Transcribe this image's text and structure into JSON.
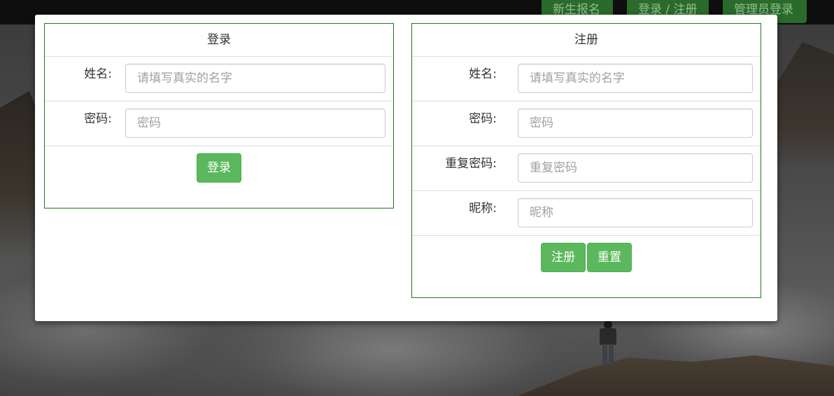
{
  "navbar": {
    "items": [
      "新生报名",
      "登录 / 注册",
      "管理员登录"
    ]
  },
  "login": {
    "title": "登录",
    "fields": [
      {
        "label": "姓名:",
        "placeholder": "请填写真实的名字"
      },
      {
        "label": "密码:",
        "placeholder": "密码"
      }
    ],
    "submit_label": "登录"
  },
  "register": {
    "title": "注册",
    "fields": [
      {
        "label": "姓名:",
        "placeholder": "请填写真实的名字"
      },
      {
        "label": "密码:",
        "placeholder": "密码"
      },
      {
        "label": "重复密码:",
        "placeholder": "重复密码"
      },
      {
        "label": "昵称:",
        "placeholder": "昵称"
      }
    ],
    "submit_label": "注册",
    "reset_label": "重置"
  },
  "colors": {
    "panel_border": "#1f7a1f",
    "button_green": "#5cb85c",
    "navbar_bg": "#0e0e0e"
  }
}
